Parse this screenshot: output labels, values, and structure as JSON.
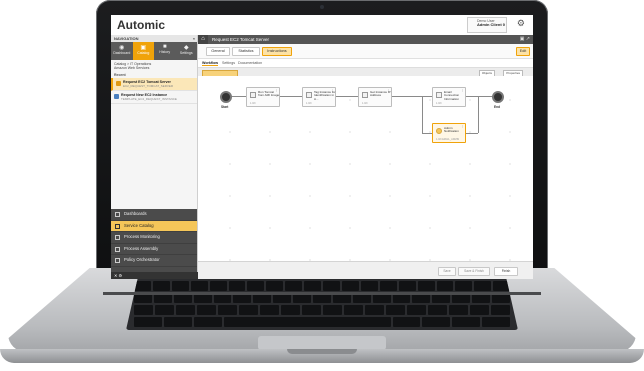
{
  "app": {
    "logo": "Automic",
    "user_line1": "Demo User",
    "user_line2": "Admin Client 0"
  },
  "navigation": {
    "header": "NAVIGATION",
    "close": "«",
    "icons": [
      {
        "glyph": "◉",
        "label": "Dashboard",
        "active": false
      },
      {
        "glyph": "▣",
        "label": "Catalog",
        "active": true
      },
      {
        "glyph": "■",
        "label": "History",
        "active": false
      },
      {
        "glyph": "◆",
        "label": "Settings",
        "active": false
      }
    ],
    "breadcrumb": "Catalog > IT Operations",
    "breadcrumb_sub": "Amazon Web Services",
    "section": "Recent",
    "items": [
      {
        "title": "Request EC2 Tomcat Server",
        "sub": "EC2_REQUEST_TOMCAT_SERVER",
        "selected": true,
        "icon": "orange"
      },
      {
        "title": "Request New EC2 Instance",
        "sub": "TEMPLATE_EC2_REQUEST_INSTANCE",
        "selected": false,
        "icon": "blue"
      }
    ],
    "lower": [
      {
        "label": "Dashboards",
        "selected": false
      },
      {
        "label": "Service Catalog",
        "selected": true
      },
      {
        "label": "Process Monitoring",
        "selected": false
      },
      {
        "label": "Process Assembly",
        "selected": false
      },
      {
        "label": "Policy Orchestrator",
        "selected": false
      }
    ],
    "footer": "✕ ⚙"
  },
  "main": {
    "title": "Request EC2 Tomcat Server",
    "home": "⌂",
    "title_right": "▣ ↗",
    "buttons": [
      "General",
      "Statistics",
      "Instructions"
    ],
    "edit_button": "Edit",
    "tabs": [
      "Workflow",
      "Settings",
      "Documentation"
    ],
    "tool_right": [
      "Objects",
      "Properties"
    ],
    "nodes": [
      {
        "title": "Run Tomcat from AMI Image",
        "sub": "1.0/0"
      },
      {
        "title": "Tag Instance for Identification in A...",
        "sub": "1.0/0"
      },
      {
        "title": "Get Instance IP Address",
        "sub": "1.0/0"
      },
      {
        "title": "Email Connection Information",
        "sub": "1.0/0"
      },
      {
        "title": "Admin Notification",
        "sub": "1.0/0 EMAIL_ADMIN"
      }
    ],
    "start_label": "Start",
    "end_label": "End",
    "footer_buttons": [
      "Save",
      "Save & Finish",
      "Finish"
    ]
  }
}
